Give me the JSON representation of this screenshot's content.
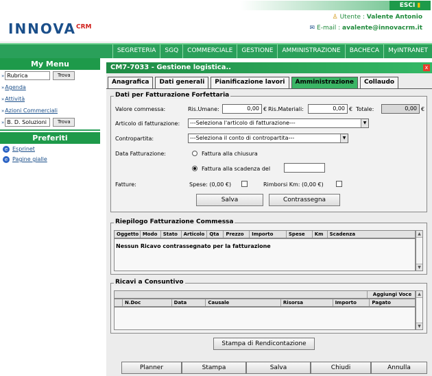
{
  "header": {
    "logo_main": "INNOVA",
    "logo_suffix": "CRM",
    "esci_label": "ESCI",
    "user_label": "Utente : ",
    "user_name": "Valente Antonio",
    "email_label": "E-mail : ",
    "email_value": "avalente@innovacrm.it"
  },
  "nav": {
    "items": [
      "SEGRETERIA",
      "SGQ",
      "COMMERCIALE",
      "GESTIONE",
      "AMMINISTRAZIONE",
      "BACHECA",
      "MyINTRANET"
    ]
  },
  "sidebar": {
    "title": "My Menu",
    "rubrica_input": "Rubrica",
    "trova_label": "Trova",
    "links": [
      "Agenda",
      "Attività",
      "Azioni Commerciali"
    ],
    "bd_input": "B. D. Soluzioni",
    "trova2_label": "Trova",
    "preferiti_title": "Preferiti",
    "favorites": [
      "Esprinet",
      "Pagine gialle"
    ]
  },
  "window": {
    "title": "CM7-7033 - Gestione logistica..",
    "close_glyph": "x",
    "tabs": [
      "Anagrafica",
      "Dati generali",
      "Pianificazione lavori",
      "Amministrazione",
      "Collaudo"
    ],
    "active_tab": "Amministrazione"
  },
  "forfettaria": {
    "legend": "Dati per Fatturazione Forfettaria",
    "valore_label": "Valore commessa:",
    "ris_umane_label": "Ris.Umane:",
    "ris_umane_value": "0,00",
    "euro1": "€",
    "ris_materiali_label": "Ris.Materiali:",
    "ris_materiali_value": "0,00",
    "euro2": "€",
    "totale_label": "Totale:",
    "totale_value": "0,00",
    "euro3": "€",
    "articolo_label": "Articolo di fatturazione:",
    "articolo_value": "---Seleziona l'articolo di fatturazione---",
    "contropartita_label": "Contropartita:",
    "contropartita_value": "---Seleziona il conto di contropartita---",
    "data_label": "Data Fatturazione:",
    "radio1_label": "Fattura alla chiusura",
    "radio2_label": "Fattura alla scadenza del",
    "fatture_label": "Fatture:",
    "spese_label": "Spese: (0,00 €)",
    "rimborsi_label": "Rimborsi Km: (0,00 €)",
    "salva_label": "Salva",
    "contrassegna_label": "Contrassegna"
  },
  "riepilogo": {
    "legend": "Riepilogo Fatturazione Commessa",
    "columns": [
      "Oggetto",
      "Modo",
      "Stato",
      "Articolo",
      "Qta",
      "Prezzo",
      "Importo",
      "Spese",
      "Km",
      "Scadenza"
    ],
    "empty_message": "Nessun Ricavo contrassegnato per la fatturazione"
  },
  "consuntivo": {
    "legend": "Ricavi a Consuntivo",
    "aggiungi_label": "Aggiungi Voce",
    "columns": [
      "",
      "N.Doc",
      "Data",
      "Causale",
      "Risorsa",
      "Importo",
      "Pagato"
    ]
  },
  "stampa_rendicontazione": "Stampa di Rendicontazione",
  "footer_buttons": [
    "Planner",
    "Stampa",
    "Salva",
    "Chiudi",
    "Annulla"
  ]
}
